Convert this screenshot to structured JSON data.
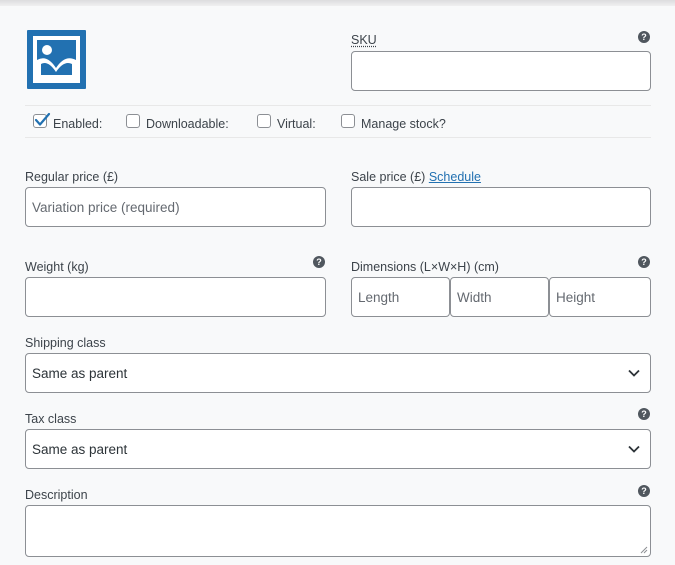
{
  "sku": {
    "label": "SKU",
    "value": ""
  },
  "options": {
    "enabled": {
      "label": "Enabled:",
      "checked": true
    },
    "downloadable": {
      "label": "Downloadable:",
      "checked": false
    },
    "virtual": {
      "label": "Virtual:",
      "checked": false
    },
    "manage_stock": {
      "label": "Manage stock?",
      "checked": false
    }
  },
  "regular_price": {
    "label": "Regular price (£)",
    "placeholder": "Variation price (required)"
  },
  "sale_price": {
    "label": "Sale price (£)",
    "schedule_link": "Schedule",
    "value": ""
  },
  "weight": {
    "label": "Weight (kg)",
    "value": ""
  },
  "dimensions": {
    "label": "Dimensions (L×W×H) (cm)",
    "length_placeholder": "Length",
    "width_placeholder": "Width",
    "height_placeholder": "Height"
  },
  "shipping_class": {
    "label": "Shipping class",
    "selected": "Same as parent"
  },
  "tax_class": {
    "label": "Tax class",
    "selected": "Same as parent"
  },
  "description": {
    "label": "Description",
    "value": ""
  },
  "help_glyph": "?",
  "colors": {
    "accent": "#2271b1",
    "border": "#8c8f94",
    "background": "#f8f9fa"
  }
}
